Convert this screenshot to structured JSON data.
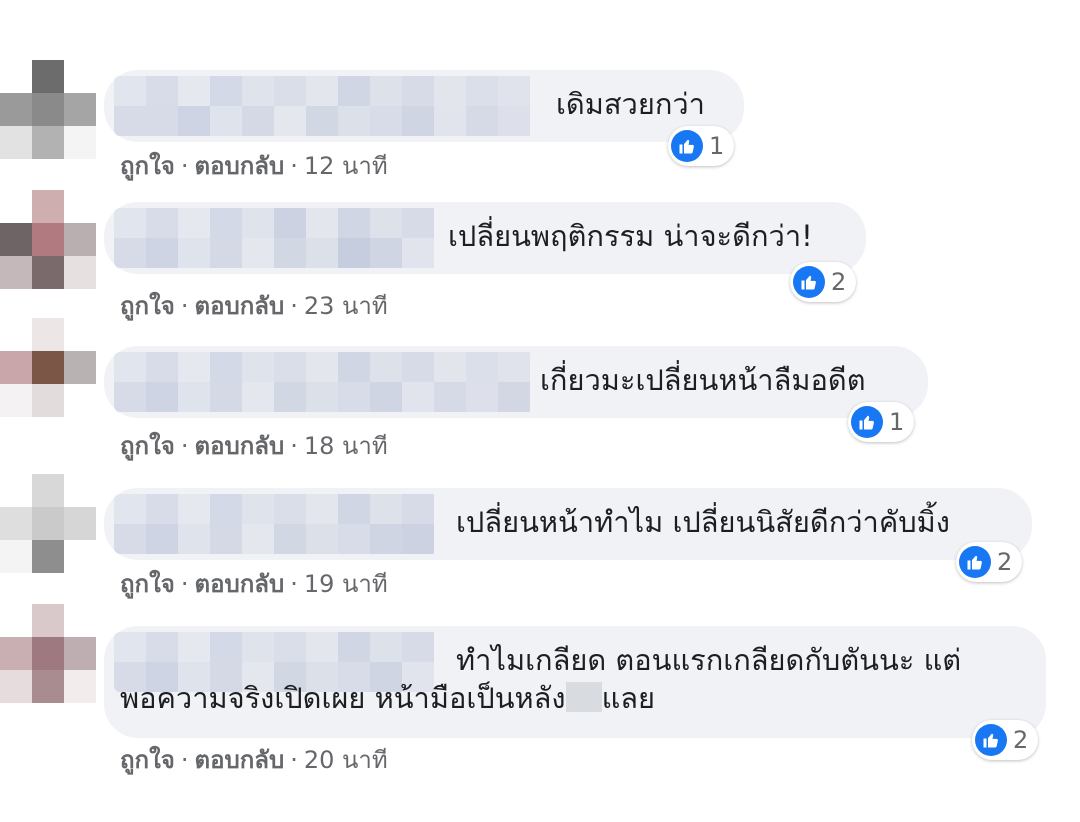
{
  "colors": {
    "bubble": "#f0f2f5",
    "like_blue": "#1877f2",
    "meta_text": "#65676b",
    "text": "#1c1e21"
  },
  "icons": {
    "like": "thumbs-up-icon"
  },
  "comments": [
    {
      "text": "เดิมสวยกว่า",
      "like_count": "1",
      "like_label": "ถูกใจ",
      "reply_label": "ตอบกลับ",
      "time": "12 นาที"
    },
    {
      "text": "เปลี่ยนพฤติกรรม น่าจะดีกว่า!",
      "like_count": "2",
      "like_label": "ถูกใจ",
      "reply_label": "ตอบกลับ",
      "time": "23 นาที"
    },
    {
      "text": "เกี่ยวมะเปลี่ยนหน้าลืมอดีต",
      "like_count": "1",
      "like_label": "ถูกใจ",
      "reply_label": "ตอบกลับ",
      "time": "18 นาที"
    },
    {
      "text": "เปลี่ยนหน้าทำไม เปลี่ยนนิสัยดีกว่าคับมิ้ง",
      "like_count": "2",
      "like_label": "ถูกใจ",
      "reply_label": "ตอบกลับ",
      "time": "19 นาที"
    },
    {
      "text_line1": "ทำไมเกลียด ตอนแรกเกลียดกับตันนะ แต่",
      "text_line2_a": "พอความจริงเปิดเผย หน้ามือเป็นหลัง",
      "text_line2_b": "แลย",
      "like_count": "2",
      "like_label": "ถูกใจ",
      "reply_label": "ตอบกลับ",
      "time": "20 นาที"
    }
  ]
}
